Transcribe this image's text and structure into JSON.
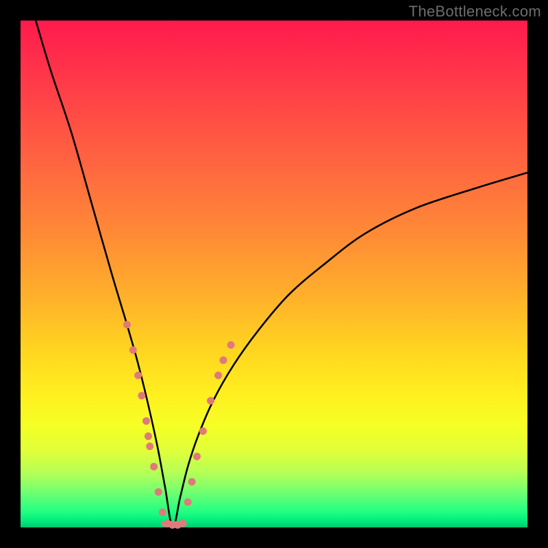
{
  "watermark": "TheBottleneck.com",
  "chart_data": {
    "type": "line",
    "title": "",
    "xlabel": "",
    "ylabel": "",
    "xlim": [
      0,
      100
    ],
    "ylim": [
      0,
      100
    ],
    "grid": false,
    "legend": false,
    "description": "Bottleneck curve: value drops from 100 to 0 at the optimum (~x=30) then rises asymptotically toward ~70 as x→100. Background gradient encodes severity (red=top=high, green=bottom=low=optimal). Salmon markers cluster around the minimum.",
    "series": [
      {
        "name": "bottleneck-curve",
        "color": "#000000",
        "x": [
          3,
          6,
          10,
          14,
          18,
          21,
          23,
          25,
          27,
          28.5,
          30,
          31.5,
          33,
          35,
          38,
          42,
          47,
          53,
          60,
          68,
          78,
          90,
          100
        ],
        "y": [
          100,
          90,
          78,
          64,
          50,
          40,
          33,
          25,
          16,
          8,
          0,
          6,
          12,
          18,
          25,
          32,
          39,
          46,
          52,
          58,
          63,
          67,
          70
        ]
      }
    ],
    "markers": {
      "name": "sample-points",
      "color": "#e07a7a",
      "radius": 5.5,
      "points": [
        {
          "x": 21.0,
          "y": 40
        },
        {
          "x": 22.2,
          "y": 35
        },
        {
          "x": 23.2,
          "y": 30
        },
        {
          "x": 23.9,
          "y": 26
        },
        {
          "x": 24.8,
          "y": 21
        },
        {
          "x": 25.2,
          "y": 18
        },
        {
          "x": 25.5,
          "y": 16
        },
        {
          "x": 26.3,
          "y": 12
        },
        {
          "x": 27.2,
          "y": 7
        },
        {
          "x": 28.0,
          "y": 3
        },
        {
          "x": 29.0,
          "y": 0.8
        },
        {
          "x": 30.0,
          "y": 0.5
        },
        {
          "x": 31.0,
          "y": 0.5
        },
        {
          "x": 32.0,
          "y": 0.8
        },
        {
          "x": 33.0,
          "y": 5
        },
        {
          "x": 33.8,
          "y": 9
        },
        {
          "x": 34.8,
          "y": 14
        },
        {
          "x": 36.0,
          "y": 19
        },
        {
          "x": 37.5,
          "y": 25
        },
        {
          "x": 39.0,
          "y": 30
        },
        {
          "x": 40.0,
          "y": 33
        },
        {
          "x": 41.5,
          "y": 36
        }
      ]
    },
    "flat_segment": {
      "x0": 28.3,
      "x1": 32.2,
      "y": 0.7
    }
  }
}
